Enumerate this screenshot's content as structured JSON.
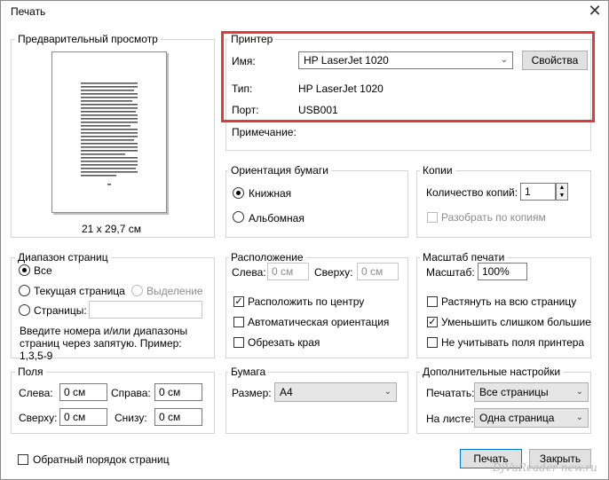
{
  "window": {
    "title": "Печать"
  },
  "preview": {
    "group_label": "Предварительный просмотр",
    "paper_size": "21 x 29,7 см"
  },
  "printer": {
    "group_label": "Принтер",
    "name_label": "Имя:",
    "name_value": "HP LaserJet 1020",
    "properties_button": "Свойства",
    "type_label": "Тип:",
    "type_value": "HP LaserJet 1020",
    "port_label": "Порт:",
    "port_value": "USB001",
    "note_label": "Примечание:"
  },
  "orientation": {
    "group_label": "Ориентация бумаги",
    "portrait": "Книжная",
    "landscape": "Альбомная",
    "selected": "portrait"
  },
  "copies": {
    "group_label": "Копии",
    "count_label": "Количество копий:",
    "count_value": "1",
    "collate_label": "Разобрать по копиям"
  },
  "range": {
    "group_label": "Диапазон страниц",
    "all": "Все",
    "current": "Текущая страница",
    "selection": "Выделение",
    "pages": "Страницы:",
    "hint": "Введите номера и/или диапазоны страниц через запятую. Пример: 1,3,5-9",
    "selected": "all"
  },
  "position": {
    "group_label": "Расположение",
    "left_label": "Слева:",
    "left_value": "0 см",
    "top_label": "Сверху:",
    "top_value": "0 см",
    "center_label": "Расположить по центру",
    "auto_label": "Автоматическая ориентация",
    "crop_label": "Обрезать края"
  },
  "scale": {
    "group_label": "Масштаб печати",
    "scale_label": "Масштаб:",
    "scale_value": "100%",
    "fit_label": "Растянуть на всю страницу",
    "shrink_label": "Уменьшить слишком большие",
    "ignore_margins_label": "Не учитывать поля принтера"
  },
  "margins": {
    "group_label": "Поля",
    "left_label": "Слева:",
    "left_value": "0 см",
    "right_label": "Справа:",
    "right_value": "0 см",
    "top_label": "Сверху:",
    "top_value": "0 см",
    "bottom_label": "Снизу:",
    "bottom_value": "0 см"
  },
  "paper": {
    "group_label": "Бумага",
    "size_label": "Размер:",
    "size_value": "A4"
  },
  "advanced": {
    "group_label": "Дополнительные настройки",
    "print_label": "Печатать:",
    "print_value": "Все страницы",
    "per_sheet_label": "На листе:",
    "per_sheet_value": "Одна страница"
  },
  "footer": {
    "reverse_label": "Обратный порядок страниц",
    "print_button": "Печать",
    "close_button": "Закрыть"
  },
  "watermark": "DjVuReader-new.ru"
}
